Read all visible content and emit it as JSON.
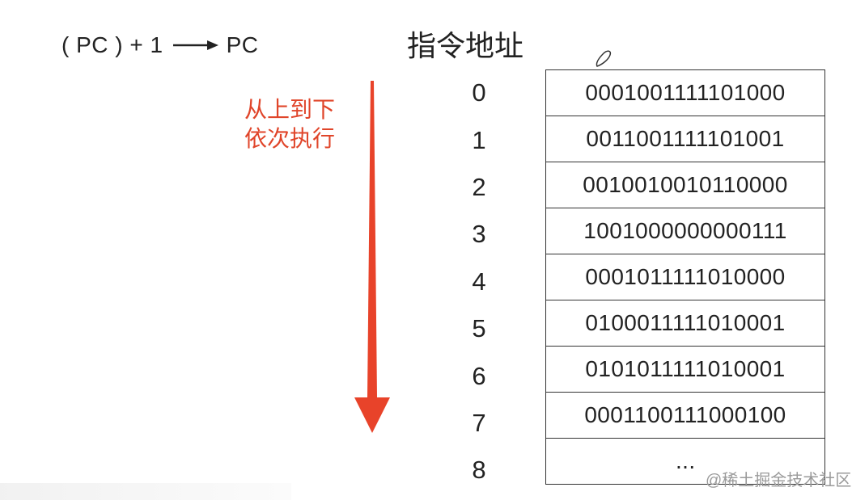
{
  "formula": {
    "lhs": "( PC ) + 1",
    "rhs": "PC"
  },
  "header": "指令地址",
  "annotation": {
    "line1": "从上到下",
    "line2": "依次执行"
  },
  "memory": {
    "addresses": [
      "0",
      "1",
      "2",
      "3",
      "4",
      "5",
      "6",
      "7",
      "8"
    ],
    "cells": [
      "0001001111101000",
      "0011001111101001",
      "0010010010110000",
      "1001000000000111",
      "0001011111010000",
      "0100011111010001",
      "0101011111010001",
      "0001100111000100",
      "..."
    ]
  },
  "watermark": "@稀土掘金技术社区",
  "colors": {
    "arrow": "#e8432a",
    "annotation": "#e0452a",
    "text": "#222222"
  }
}
